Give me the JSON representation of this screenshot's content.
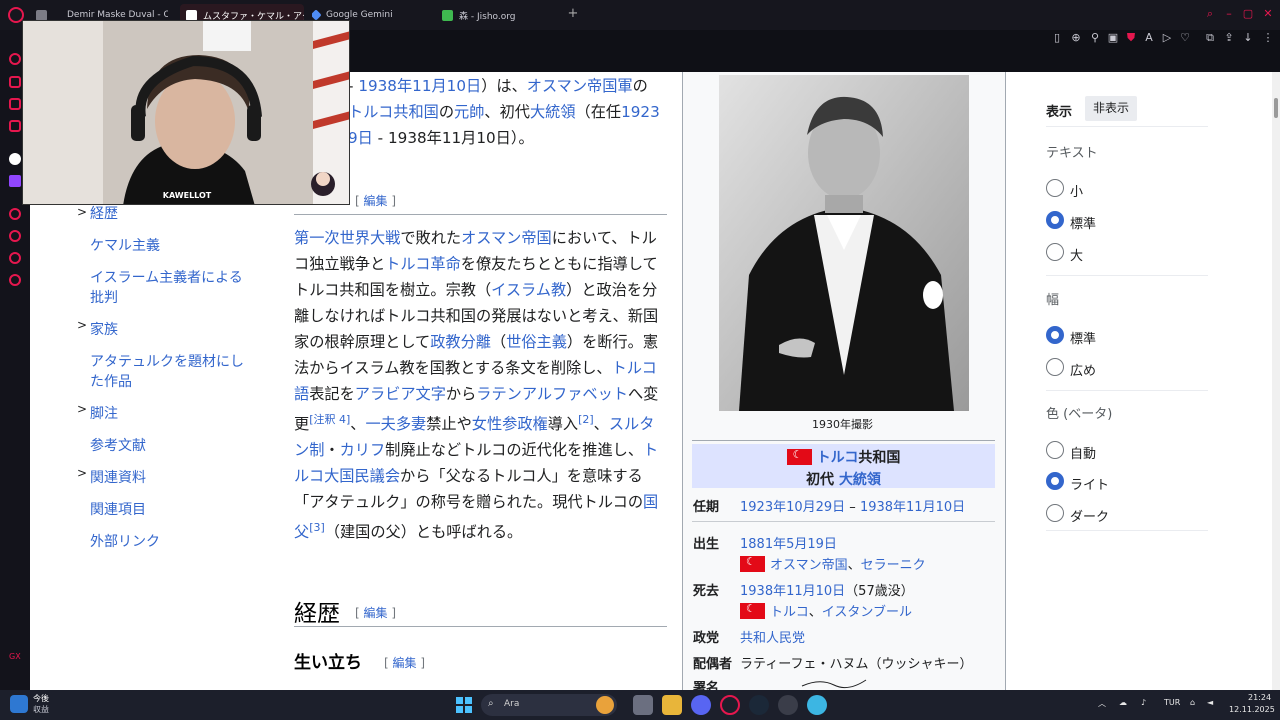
{
  "tabs": [
    {
      "label": "Demir Maske Duval - One"
    },
    {
      "label": "ムスタファ・ケマル・アタテュルク"
    },
    {
      "label": "Google Gemini"
    },
    {
      "label": "森 - Jisho.org"
    }
  ],
  "toc": {
    "items": [
      {
        "label": "経歴",
        "caret": ">"
      },
      {
        "label": "ケマル主義",
        "caret": ""
      },
      {
        "label": "イスラーム主義者による批判",
        "caret": ""
      },
      {
        "label": "家族",
        "caret": ">"
      },
      {
        "label": "アタテュルクを題材にした作品",
        "caret": ""
      },
      {
        "label": "脚注",
        "caret": ">"
      },
      {
        "label": "参考文献",
        "caret": ""
      },
      {
        "label": "関連資料",
        "caret": ">"
      },
      {
        "label": "関連項目",
        "caret": ""
      },
      {
        "label": "外部リンク",
        "caret": ""
      }
    ]
  },
  "article": {
    "intro": {
      "t1": "- ",
      "l1": "1938年11月10日",
      "t2": "）は、",
      "l2": "オスマン帝国軍",
      "t3": "の",
      "l3": "トルコ共和国",
      "t4": "の",
      "l4": "元帥",
      "t5": "、初代",
      "l5": "大統領",
      "t6": "（在任",
      "l6": "1923",
      "l7": "9日",
      "t7": " - 1938年11月10日）。"
    },
    "edit_open": "[ ",
    "edit_close": " ]",
    "edit_label": "編集",
    "body": {
      "l1": "第一次世界大戦",
      "t1": "で敗れた",
      "l2": "オスマン帝国",
      "t2": "において、トルコ独立戦争と",
      "l3": "トルコ革命",
      "t3": "を僚友たちとともに指導してトルコ共和国を樹立。宗教（",
      "l4": "イスラム教",
      "t4": "）と政治を分離しなければトルコ共和国の発展はないと考え、新国家の根幹原理として",
      "l5": "政教分離",
      "t5": "（",
      "l6": "世俗主義",
      "t6": "）を断行。憲法からイスラム教を国教とする条文を削除し、",
      "l7": "トルコ語",
      "t7": "表記を",
      "l8": "アラビア文字",
      "t8": "から",
      "l9": "ラテンアルファベット",
      "t9": "へ変更",
      "n1": "[注釈 4]",
      "t10": "、",
      "l10": "一夫多妻",
      "t11": "禁止や",
      "l11": "女性参政権",
      "t12": "導入",
      "n2": "[2]",
      "t13": "、",
      "l12": "スルタン制",
      "t14": "・",
      "l13": "カリフ",
      "t15": "制廃止などトルコの近代化を推進し、",
      "l14": "トルコ大国民議会",
      "t16": "から「父なるトルコ人」を意味する「アタテュルク」の称号を贈られた。現代トルコの",
      "l15": "国父",
      "n3": "[3]",
      "t17": "（建国の父）とも呼ばれる。"
    },
    "h2": "経歴",
    "h3": "生い立ち"
  },
  "infobox": {
    "caption": "1930年撮影",
    "title_link": "トルコ",
    "title_rest": "共和国",
    "subtitle_pre": "初代 ",
    "subtitle_link": "大統領",
    "rows": {
      "term_label": "任期",
      "term_from": "1923年10月29日",
      "term_dash": " – ",
      "term_to": "1938年11月10日",
      "birth_label": "出生",
      "birth_date": "1881年5月19日",
      "birth_place1": "オスマン帝国",
      "birth_sep": "、",
      "birth_place2": "セラーニク",
      "death_label": "死去",
      "death_date": "1938年11月10日",
      "death_age": "（57歳没）",
      "death_place1": "トルコ",
      "death_sep": "、",
      "death_place2": "イスタンブール",
      "party_label": "政党",
      "party_value": "共和人民党",
      "spouse_label": "配偶者",
      "spouse_value": "ラティーフェ・ハヌム（ウッシャキー）",
      "sign_label": "署名"
    }
  },
  "appearance": {
    "title": "表示",
    "hide": "非表示",
    "text_label": "テキスト",
    "text_options": [
      "小",
      "標準",
      "大"
    ],
    "width_label": "幅",
    "width_options": [
      "標準",
      "広め"
    ],
    "color_label": "色 (ベータ)",
    "color_options": [
      "自動",
      "ライト",
      "ダーク"
    ]
  },
  "webcam": {
    "tag": "KAWELLOT"
  },
  "taskbar": {
    "weather_temp": "今後",
    "weather_desc": "収益",
    "search": "Ara",
    "lang": "TUR",
    "time": "21:24",
    "date": "12.11.2025"
  }
}
